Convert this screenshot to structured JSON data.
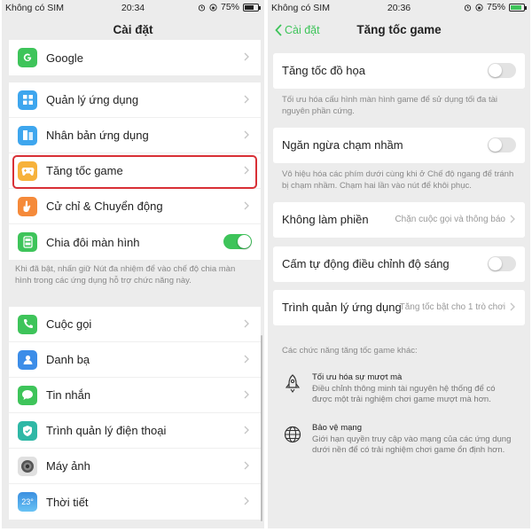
{
  "left": {
    "status": {
      "sim": "Không có SIM",
      "time": "20:34",
      "battery": "75%"
    },
    "title": "Cài đặt",
    "group_top": [
      {
        "label": "Google",
        "icon": "google-icon",
        "color": "#3ec45a"
      }
    ],
    "group_apps": [
      {
        "label": "Quản lý ứng dụng",
        "icon": "apps-grid-icon",
        "color": "#3ea6ee"
      },
      {
        "label": "Nhân bản ứng dụng",
        "icon": "clone-icon",
        "color": "#3ea6ee"
      },
      {
        "label": "Tăng tốc game",
        "icon": "gamepad-icon",
        "color": "#f7b23b"
      },
      {
        "label": "Cử chỉ & Chuyển động",
        "icon": "hand-gesture-icon",
        "color": "#f58a3a"
      },
      {
        "label": "Chia đôi màn hình",
        "icon": "split-screen-icon",
        "color": "#3ec45a",
        "toggle_on": true
      }
    ],
    "split_hint": "Khi đã bật, nhấn giữ Nút đa nhiệm để vào chế độ chia màn hình trong các ứng dụng hỗ trợ chức năng này.",
    "group_system": [
      {
        "label": "Cuộc gọi",
        "icon": "phone-icon",
        "color": "#3ec45a"
      },
      {
        "label": "Danh bạ",
        "icon": "contacts-icon",
        "color": "#3c8de8"
      },
      {
        "label": "Tin nhắn",
        "icon": "message-icon",
        "color": "#3ec45a"
      },
      {
        "label": "Trình quản lý điện thoại",
        "icon": "shield-icon",
        "color": "#2fb8a6"
      },
      {
        "label": "Máy ảnh",
        "icon": "camera-icon",
        "color": "#9a9a9a"
      },
      {
        "label": "Thời tiết",
        "icon": "weather-icon",
        "color": "#3ea6ee",
        "icon_text": "23°"
      }
    ]
  },
  "right": {
    "status": {
      "sim": "Không có SIM",
      "time": "20:36",
      "battery": "75%"
    },
    "back_label": "Cài đặt",
    "title": "Tăng tốc game",
    "graphics": {
      "label": "Tăng tốc đồ họa",
      "hint": "Tối ưu hóa cấu hình màn hình game để sử dụng tối đa tài nguyên phần cứng."
    },
    "mistouch": {
      "label": "Ngăn ngừa chạm nhầm",
      "hint": "Vô hiệu hóa các phím dưới cùng khi ở Chế độ ngang để tránh bị chạm nhầm. Chạm hai lần vào nút để khôi phục."
    },
    "dnd": {
      "label": "Không làm phiền",
      "value": "Chặn cuộc gọi và thông báo"
    },
    "brightness": {
      "label": "Cấm tự động điều chỉnh độ sáng"
    },
    "app_manager": {
      "label": "Trình quản lý ứng dụng",
      "value": "Tăng tốc bật cho 1 trò chơi"
    },
    "other_header": "Các chức năng tăng tốc game khác:",
    "features": [
      {
        "title": "Tối ưu hóa sự mượt mà",
        "desc": "Điều chỉnh thông minh tài nguyên hệ thống để có được một trải nghiệm chơi game mượt mà hơn.",
        "icon": "rocket-icon"
      },
      {
        "title": "Bảo vệ mạng",
        "desc": "Giới hạn quyền truy cập vào mạng của các ứng dụng dưới nền để có trải nghiệm chơi game ổn định hơn.",
        "icon": "globe-icon"
      }
    ]
  }
}
